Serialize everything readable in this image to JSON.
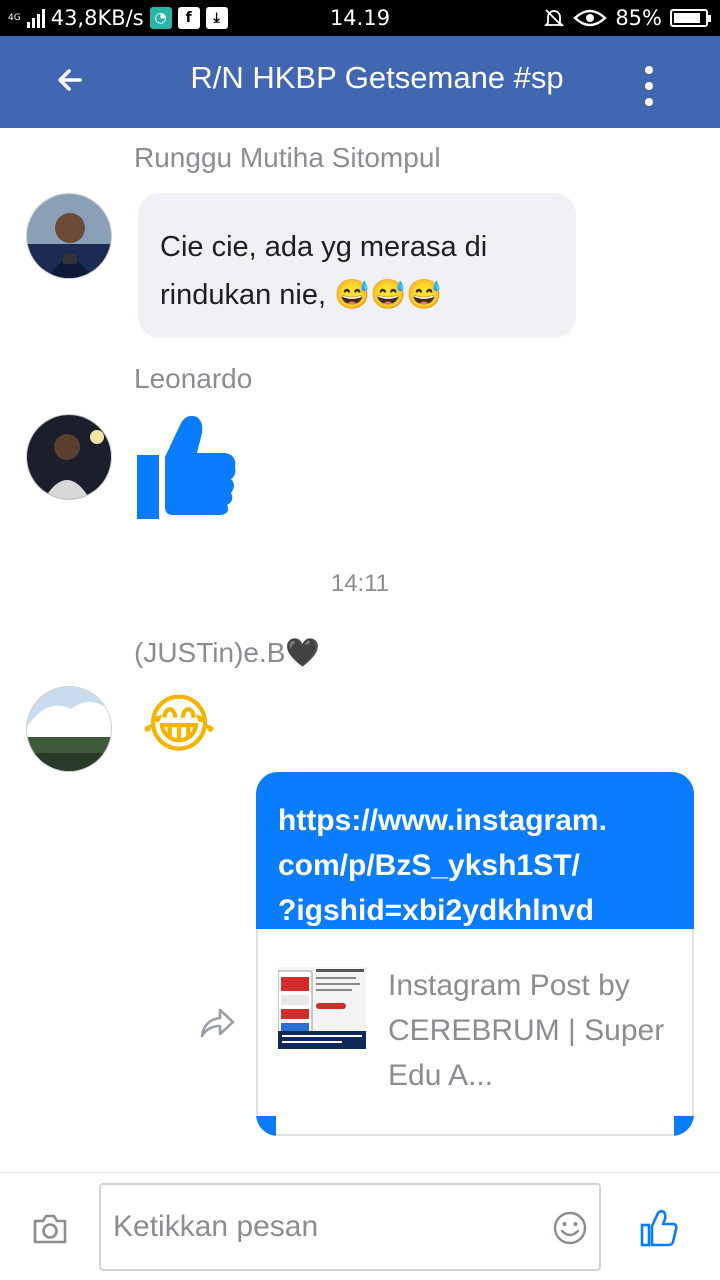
{
  "status_bar": {
    "net_speed": "43,8KB/s",
    "network_label": "4G",
    "time": "14.19",
    "battery": "85%",
    "battery_level": 0.85
  },
  "header": {
    "title": "R/N HKBP Getsemane #sp"
  },
  "messages": [
    {
      "sender": "Runggu Mutiha Sitompul",
      "text": "Cie cie, ada yg merasa di rindukan nie, 😅😅😅"
    },
    {
      "sender": "Leonardo",
      "type": "like"
    },
    {
      "timestamp": "14:11"
    },
    {
      "sender": "(JUSTin)e.B🖤",
      "type": "emoji",
      "emoji": "😂"
    },
    {
      "outgoing": true,
      "link_lines": [
        "https://www.instagram.",
        "com/p/BzS_yksh1ST/",
        "?igshid=xbi2ydkhlnvd"
      ],
      "preview_title": "Instagram Post by CEREBRUM | Super Edu A..."
    }
  ],
  "composer": {
    "placeholder": "Ketikkan pesan"
  },
  "colors": {
    "header": "#4167b2",
    "accent_blue": "#0a7cff",
    "bubble_gray": "#f0f1f4",
    "meta_gray": "#8a8d91"
  },
  "icons": [
    "back-arrow-icon",
    "more-vert-icon",
    "thumbs-up-icon",
    "share-icon",
    "camera-icon",
    "smiley-icon",
    "like-send-icon"
  ]
}
